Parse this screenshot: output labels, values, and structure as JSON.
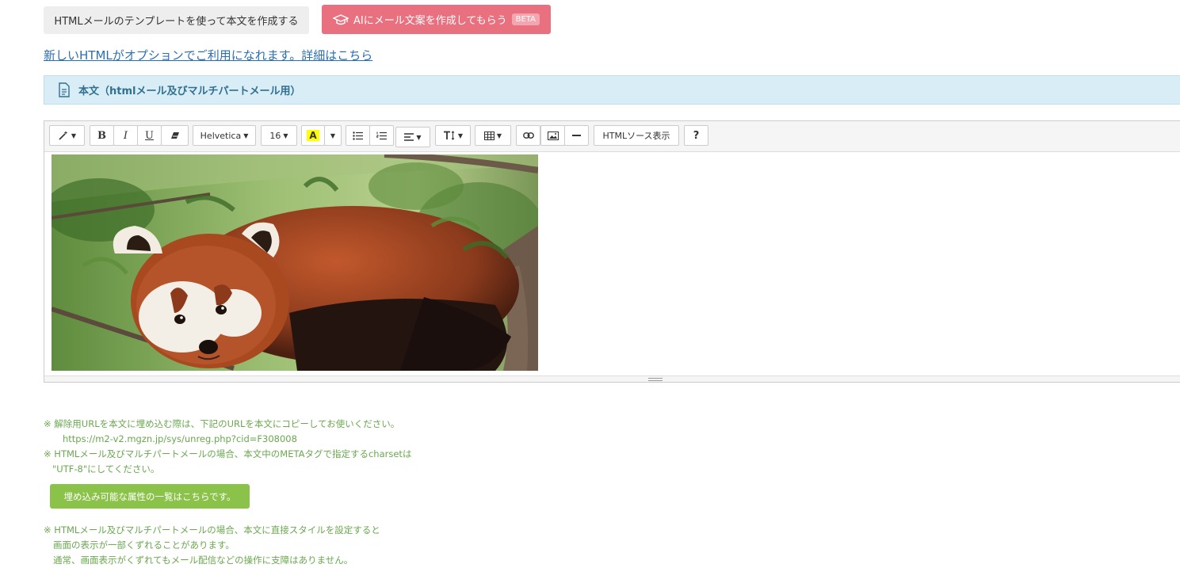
{
  "buttons": {
    "template_label": "HTMLメールのテンプレートを使って本文を作成する",
    "ai_label": "AIにメール文案を作成してもらう",
    "ai_badge": "BETA"
  },
  "notice_link": "新しいHTMLがオプションでご利用になれます。詳細はこちら",
  "section": {
    "title": "本文（htmlメール及びマルチパートメール用）",
    "icon": "document-icon"
  },
  "toolbar": {
    "bold": "B",
    "italic": "I",
    "underline": "U",
    "font_family": "Helvetica",
    "font_size": "16",
    "highlight": "A",
    "html_source": "HTMLソース表示",
    "help": "?"
  },
  "content": {
    "image": "red-panda-photo"
  },
  "notes": {
    "line1": "※ 解除用URLを本文に埋め込む際は、下記のURLを本文にコピーしてお使いください。",
    "url": "https://m2-v2.mgzn.jp/sys/unreg.php?cid=F308008",
    "line2": "※ HTMLメール及びマルチパートメールの場合、本文中のMETAタグで指定するcharsetは",
    "line3": "\"UTF-8\"にしてください。",
    "attr_button": "埋め込み可能な属性の一覧はこちらです。",
    "line4": "※ HTMLメール及びマルチパートメールの場合、本文に直接スタイルを設定すると",
    "line5": "画面の表示が一部くずれることがあります。",
    "line6": "通常、画面表示がくずれてもメール配信などの操作に支障はありません。"
  },
  "colors": {
    "ai_button": "#e9707f",
    "section_bg": "#d9edf7",
    "note_text": "#6aa84f",
    "attr_button": "#8bc34a",
    "link": "#2a6fb4"
  }
}
